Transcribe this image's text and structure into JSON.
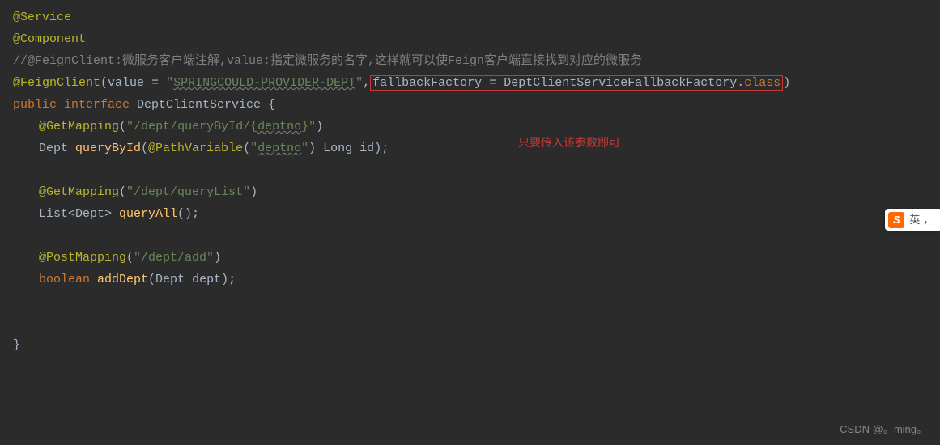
{
  "code": {
    "line1": {
      "annotation": "@Service"
    },
    "line2": {
      "annotation": "@Component"
    },
    "line3": {
      "comment": "//@FeignClient:微服务客户端注解,value:指定微服务的名字,这样就可以使Feign客户端直接找到对应的微服务"
    },
    "line4": {
      "annotation": "@FeignClient",
      "paren_open": "(",
      "value_key": "value = ",
      "value_string_open": "\"",
      "value_string_content": "SPRINGCOULD-PROVIDER-DEPT",
      "value_string_close": "\"",
      "comma": ",",
      "fallback_key": "fallbackFactory = ",
      "fallback_class": "DeptClientServiceFallbackFactory",
      "dot_class": ".",
      "class_kw": "class",
      "paren_close": ")"
    },
    "line5": {
      "public": "public ",
      "interface": "interface ",
      "name": "DeptClientService ",
      "brace": "{"
    },
    "line6": {
      "annotation": "@GetMapping",
      "paren_open": "(",
      "string_open": "\"",
      "path1": "/dept/queryById/{",
      "path_var": "deptno",
      "path2": "}",
      "string_close": "\"",
      "paren_close": ")"
    },
    "line7": {
      "return_type": "Dept ",
      "method": "queryById",
      "paren_open": "(",
      "annotation": "@PathVariable",
      "inner_open": "(",
      "string_open": "\"",
      "string_content": "deptno",
      "string_close": "\"",
      "inner_close": ") ",
      "param_type": "Long ",
      "param_name": "id",
      "paren_close": ");"
    },
    "line9": {
      "annotation": "@GetMapping",
      "paren_open": "(",
      "string": "\"/dept/queryList\"",
      "paren_close": ")"
    },
    "line10": {
      "return_type": "List<Dept> ",
      "method": "queryAll",
      "parens": "();"
    },
    "line12": {
      "annotation": "@PostMapping",
      "paren_open": "(",
      "string": "\"/dept/add\"",
      "paren_close": ")"
    },
    "line13": {
      "return_type": "boolean ",
      "method": "addDept",
      "paren_open": "(",
      "param_type": "Dept ",
      "param_name": "dept",
      "paren_close": ");"
    },
    "line_end": {
      "brace": "}"
    }
  },
  "red_note": "只要传入该参数即可",
  "watermark": "CSDN @。ming。",
  "ime": {
    "icon": "S",
    "text": "英 ，"
  }
}
